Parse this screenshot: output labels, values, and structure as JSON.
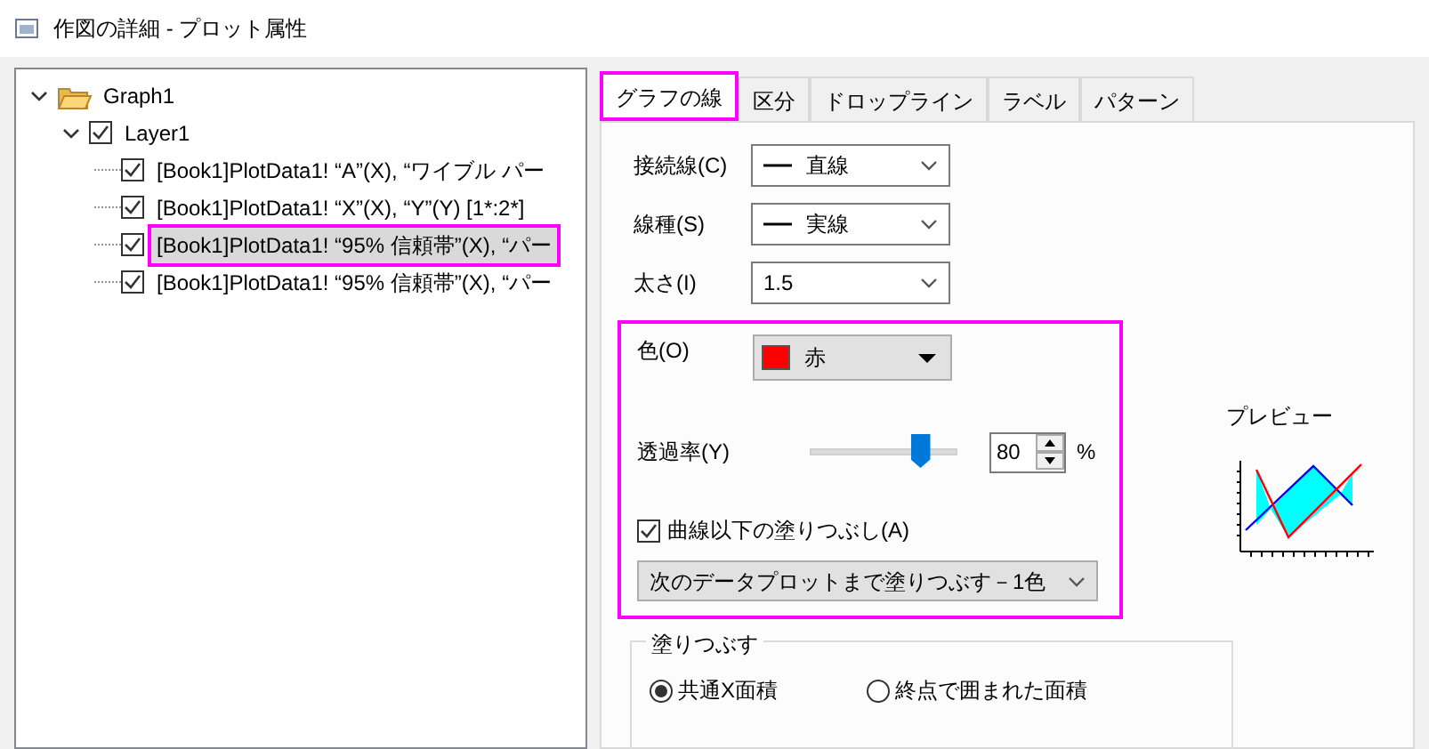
{
  "window": {
    "title": "作図の詳細 - プロット属性"
  },
  "tree": {
    "items": [
      {
        "label": "Graph1",
        "kind": "folder",
        "expanded": true,
        "children": [
          {
            "label": "Layer1",
            "kind": "check",
            "checked": true,
            "expanded": true,
            "children": [
              {
                "label": "[Book1]PlotData1! “A”(X), “ワイブル パー",
                "kind": "check",
                "checked": true,
                "selected": false
              },
              {
                "label": "[Book1]PlotData1! “X”(X), “Y”(Y) [1*:2*]",
                "kind": "check",
                "checked": true,
                "selected": false
              },
              {
                "label": "[Book1]PlotData1! “95% 信頼帯”(X), “パー",
                "kind": "check",
                "checked": true,
                "selected": true
              },
              {
                "label": "[Book1]PlotData1! “95% 信頼帯”(X), “パー",
                "kind": "check",
                "checked": true,
                "selected": false
              }
            ]
          }
        ]
      }
    ]
  },
  "tabs": [
    {
      "label": "グラフの線",
      "selected": true
    },
    {
      "label": "区分",
      "selected": false
    },
    {
      "label": "ドロップライン",
      "selected": false
    },
    {
      "label": "ラベル",
      "selected": false
    },
    {
      "label": "パターン",
      "selected": false
    }
  ],
  "fields": [
    {
      "label": "接続線(C)",
      "value": "直線",
      "kind": "line"
    },
    {
      "label": "線種(S)",
      "value": "実線",
      "kind": "line"
    },
    {
      "label": "太さ(I)",
      "value": "1.5",
      "kind": "plain"
    }
  ],
  "color_section": {
    "highlighted": true,
    "color": {
      "label": "色(O)",
      "value": "赤",
      "color": "#ff0000"
    },
    "transparency": {
      "label": "透過率(Y)",
      "level": 0.75,
      "value": "80",
      "unit": "%"
    },
    "fill_under": {
      "label": "曲線以下の塗りつぶし(A)",
      "checked": true
    },
    "fill_mode": {
      "value": "次のデータプロットまで塗りつぶす－1色"
    }
  },
  "fill_group": {
    "title": "塗りつぶす",
    "options": [
      {
        "label": "共通X面積",
        "selected": true
      },
      {
        "label": "終点で囲まれた面積",
        "selected": false
      }
    ]
  },
  "preview": {
    "label": "プレビュー"
  }
}
